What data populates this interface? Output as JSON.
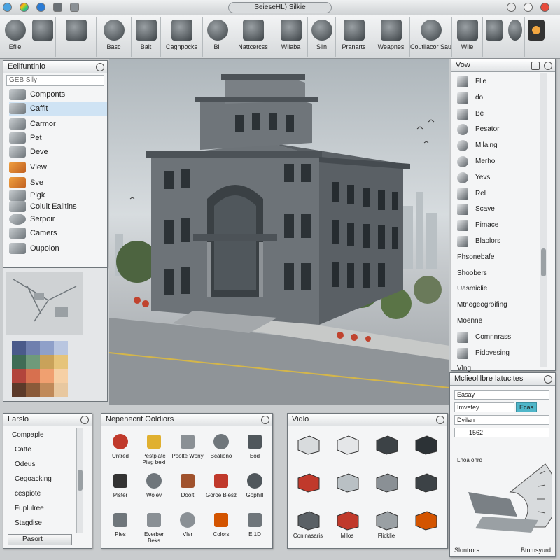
{
  "window": {
    "title": "SeieseHL) Silkie"
  },
  "toolbar": {
    "items": [
      {
        "label": "Efile",
        "icon": "gear-icon"
      },
      {
        "label": "",
        "icon": "house-icon"
      },
      {
        "label": "",
        "icon": "sketch-icon"
      },
      {
        "label": "Basc",
        "icon": "nodes-icon"
      },
      {
        "label": "Balt",
        "icon": "pipe-icon"
      },
      {
        "label": "Cagnpocks",
        "icon": "pen-icon"
      },
      {
        "label": "Bll",
        "icon": "phone-icon"
      },
      {
        "label": "Nattcercss",
        "icon": "pencil-icon"
      },
      {
        "label": "Wllaba",
        "icon": "box-icon"
      },
      {
        "label": "Siln",
        "icon": "notes-icon"
      },
      {
        "label": "Pranarts",
        "icon": "chair-icon"
      },
      {
        "label": "Weapnes",
        "icon": "block-icon"
      },
      {
        "label": "Coutilacor Sauarl",
        "icon": "settings-icon"
      },
      {
        "label": "Wlle",
        "icon": "move-icon"
      },
      {
        "label": "",
        "icon": "window-icon"
      },
      {
        "label": "",
        "icon": "dice-icon"
      },
      {
        "label": "",
        "icon": "flower-icon"
      }
    ]
  },
  "left_panel": {
    "title": "Eelifuntlnlo",
    "search_value": "GEB Slly",
    "items": [
      {
        "label": "Componts"
      },
      {
        "label": "Caffit"
      },
      {
        "label": "Carmor"
      },
      {
        "label": "Pet"
      },
      {
        "label": "Deve"
      },
      {
        "label": "Vlew"
      },
      {
        "label": "Sve"
      },
      {
        "label": "Plgk"
      },
      {
        "label": "Colult Ealitins"
      },
      {
        "label": "Serpoir"
      },
      {
        "label": "Camers"
      },
      {
        "label": "Oupolon"
      }
    ]
  },
  "right_panel": {
    "title": "Vow",
    "items": [
      {
        "label": "Flle"
      },
      {
        "label": "do"
      },
      {
        "label": "Be"
      },
      {
        "label": "Pesator"
      },
      {
        "label": "Mllaing"
      },
      {
        "label": "Merho"
      },
      {
        "label": "Yevs"
      },
      {
        "label": "Rel"
      },
      {
        "label": "Scave"
      },
      {
        "label": "Pimace"
      },
      {
        "label": "Blaolors"
      },
      {
        "label": "Phsonebafe"
      },
      {
        "label": "Shoobers"
      },
      {
        "label": "Uasmiclie"
      },
      {
        "label": "Mtnegeogroifing"
      },
      {
        "label": "Moenne"
      },
      {
        "label": "Comnnrass"
      },
      {
        "label": "Pidovesing"
      },
      {
        "label": "Vlng"
      }
    ]
  },
  "materials_panel": {
    "title": "Mclieolilbre latucites",
    "field1_value": "Easay",
    "field2_value": "Imvefey",
    "field2_button": "Ecas",
    "field3_value": "Dyilan",
    "field4_value": "1562",
    "footer_left": "Slontrors",
    "footer_right": "Btnmsyurd",
    "tag": "Lnoa onrd"
  },
  "layers_panel": {
    "title": "Larslo",
    "items": [
      {
        "label": "Compaple"
      },
      {
        "label": "Catte"
      },
      {
        "label": "Odeus"
      },
      {
        "label": "Cegoacking"
      },
      {
        "label": "cespiote"
      },
      {
        "label": "Fuplulree"
      },
      {
        "label": "Stagdise"
      }
    ],
    "button": "Pasort"
  },
  "components_panel": {
    "title": "Nepenecrit Ooldiors",
    "cells": [
      {
        "label": "Untred"
      },
      {
        "label": "Pestpiate Pieg bexi"
      },
      {
        "label": "Poolte Wony"
      },
      {
        "label": "Bcaliono"
      },
      {
        "label": "Eod"
      },
      {
        "label": "Plster"
      },
      {
        "label": "Wolev"
      },
      {
        "label": "Dooit"
      },
      {
        "label": "Goroe Biesz"
      },
      {
        "label": "Gophill"
      },
      {
        "label": "Pies"
      },
      {
        "label": "Everber Beks"
      },
      {
        "label": "Vler"
      },
      {
        "label": "Colors"
      },
      {
        "label": "EI1D"
      }
    ]
  },
  "vidlo_panel": {
    "title": "Vidlo",
    "cells": [
      {
        "label": ""
      },
      {
        "label": ""
      },
      {
        "label": ""
      },
      {
        "label": ""
      },
      {
        "label": ""
      },
      {
        "label": ""
      },
      {
        "label": ""
      },
      {
        "label": ""
      },
      {
        "label": "Conlnasaris"
      },
      {
        "label": "Mllos"
      },
      {
        "label": "Flicklie"
      },
      {
        "label": ""
      }
    ]
  },
  "colors": {
    "accent": "#d9e8f5",
    "swatches": [
      "#4a5a8a",
      "#6f7fae",
      "#8fa0c9",
      "#b9c6e0",
      "#3f6c55",
      "#6f9a7a",
      "#c9a25a",
      "#e6c47a",
      "#b2443c",
      "#d7704f",
      "#f0a070",
      "#f6d0a5",
      "#5c3a2a",
      "#8a5a3a",
      "#c08a5a",
      "#e8c8a0"
    ]
  }
}
